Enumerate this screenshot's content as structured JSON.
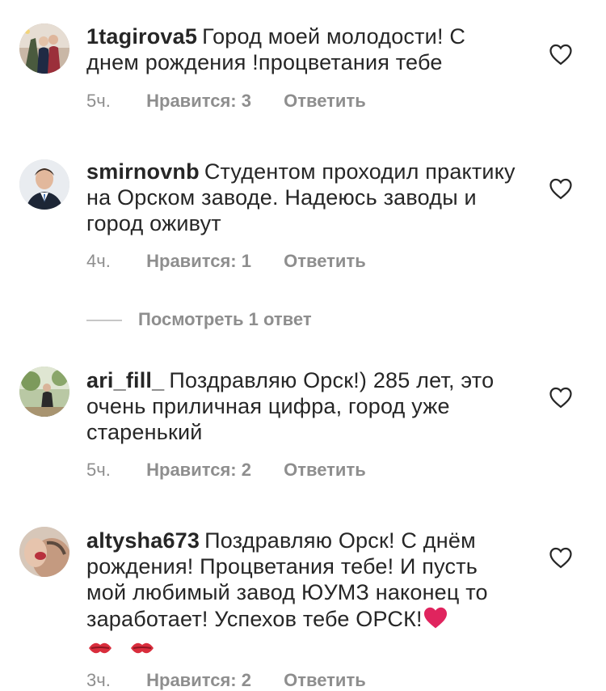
{
  "comments": [
    {
      "username": "1tagirova5",
      "text": "Город моей молодости! С днем рождения !процветания тебе",
      "time": "5ч.",
      "likes": "Нравится: 3",
      "reply": "Ответить"
    },
    {
      "username": "smirnovnb",
      "text": "Студентом проходил практику на Орском заводе. Надеюсь заводы и город оживут",
      "time": "4ч.",
      "likes": "Нравится: 1",
      "reply": "Ответить"
    },
    {
      "username": "ari_fill_",
      "text": "Поздравляю Орск!) 285 лет, это очень приличная цифра, город уже старенький",
      "time": "5ч.",
      "likes": "Нравится: 2",
      "reply": "Ответить"
    },
    {
      "username": "altysha673",
      "text": "Поздравляю Орск! С днём рождения! Процветания тебе! И пусть мой любимый завод ЮУМЗ  наконец то заработает! Успехов тебе ОРСК!",
      "time": "3ч.",
      "likes": "Нравится: 2",
      "reply": "Ответить"
    }
  ],
  "view_replies": "Посмотреть 1 ответ",
  "icons": {
    "like": "heart-outline-icon",
    "emoji_heart": "red-heart-emoji",
    "emoji_kiss": "kiss-mark-emoji"
  },
  "colors": {
    "text": "#262626",
    "secondary": "#8e8e8e",
    "heart_emoji": "#e0245e",
    "kiss_emoji": "#d92d3c"
  }
}
